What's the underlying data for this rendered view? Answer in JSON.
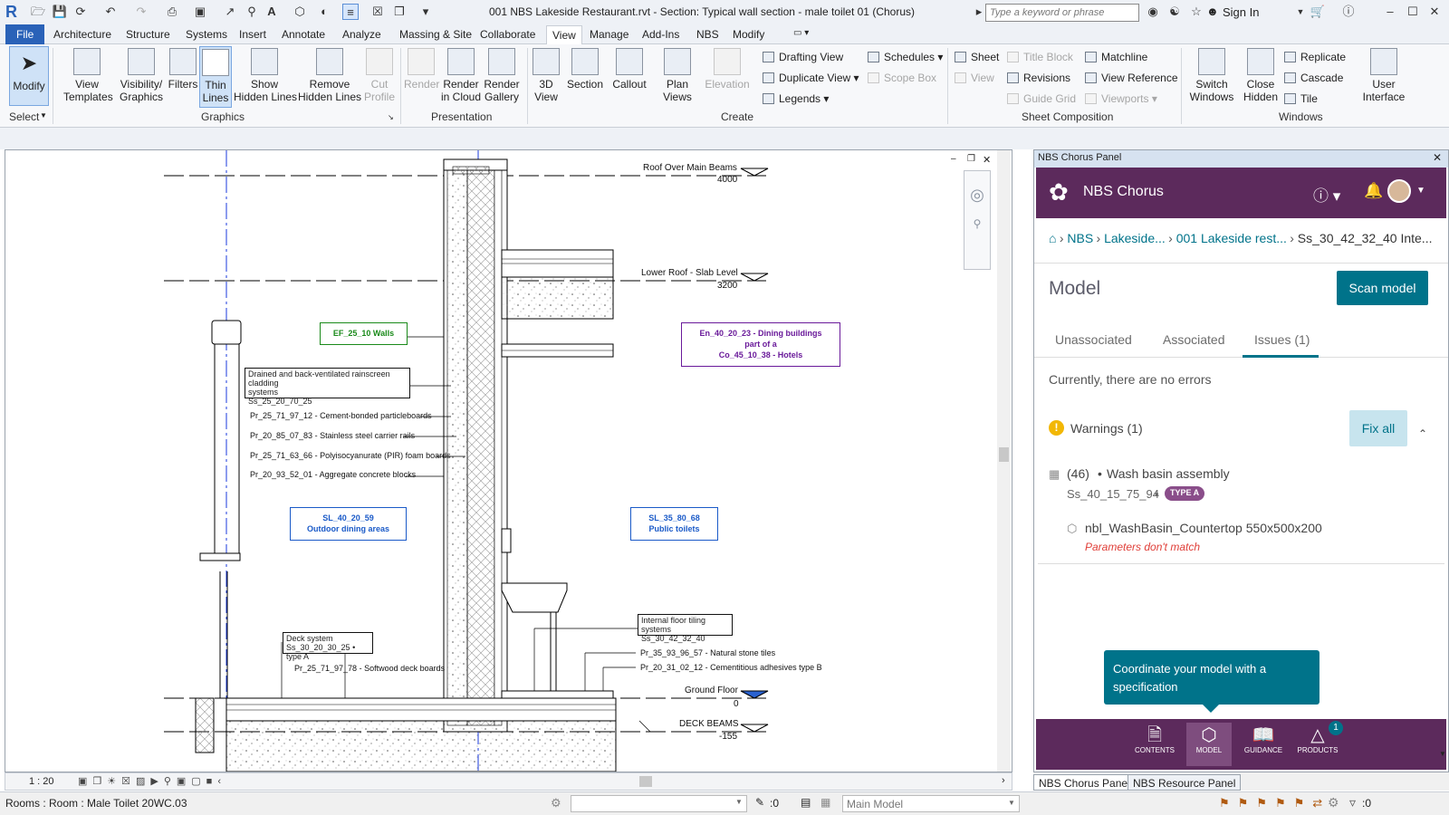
{
  "window": {
    "title": "001 NBS Lakeside Restaurant.rvt - Section: Typical wall section - male toilet 01 (Chorus)",
    "search_placeholder": "Type a keyword or phrase",
    "sign_in": "Sign In"
  },
  "tabs": [
    "File",
    "Architecture",
    "Structure",
    "Systems",
    "Insert",
    "Annotate",
    "Analyze",
    "Massing & Site",
    "Collaborate",
    "View",
    "Manage",
    "Add-Ins",
    "NBS",
    "Modify"
  ],
  "active_tab": "View",
  "ribbon": {
    "modify": "Modify",
    "select": "Select",
    "graphics": {
      "group": "Graphics",
      "view_templates": "View\nTemplates",
      "visibility": "Visibility/\nGraphics",
      "filters": "Filters",
      "thin_lines": "Thin\nLines",
      "show_hidden": "Show\nHidden Lines",
      "remove_hidden": "Remove\nHidden Lines",
      "cut_profile": "Cut\nProfile"
    },
    "presentation": {
      "group": "Presentation",
      "render": "Render",
      "render_cloud": "Render\nin Cloud",
      "render_gallery": "Render\nGallery"
    },
    "create": {
      "group": "Create",
      "view3d": "3D\nView",
      "section": "Section",
      "callout": "Callout",
      "plan_views": "Plan\nViews",
      "elevation": "Elevation",
      "drafting_view": "Drafting View",
      "duplicate_view": "Duplicate View",
      "legends": "Legends",
      "schedules": "Schedules",
      "scope_box": "Scope Box"
    },
    "sheet": {
      "group": "Sheet Composition",
      "sheet": "Sheet",
      "view": "View",
      "title_block": "Title Block",
      "revisions": "Revisions",
      "guide_grid": "Guide Grid",
      "matchline": "Matchline",
      "view_reference": "View Reference",
      "viewports": "Viewports"
    },
    "windows": {
      "group": "Windows",
      "switch_windows": "Switch\nWindows",
      "close_hidden": "Close\nHidden",
      "replicate": "Replicate",
      "cascade": "Cascade",
      "tile": "Tile",
      "user_interface": "User\nInterface"
    }
  },
  "drawing": {
    "level_roof": "Roof Over Main Beams",
    "level_roof_val": "4000",
    "level_lower": "Lower Roof - Slab Level",
    "level_lower_val": "3200",
    "level_ground": "Ground Floor",
    "level_ground_val": "0",
    "level_deck": "DECK BEAMS",
    "level_deck_val": "-155",
    "tag_walls": "EF_25_10 Walls",
    "tag_dining_1": "En_40_20_23 - Dining buildings",
    "tag_dining_2": "part of a",
    "tag_dining_3": "Co_45_10_38 - Hotels",
    "tag_outdoor_1": "SL_40_20_59",
    "tag_outdoor_2": "Outdoor dining areas",
    "tag_toilets_1": "SL_35_80_68",
    "tag_toilets_2": "Public toilets",
    "note_cladding_1": "Drained and back-ventilated rainscreen cladding",
    "note_cladding_2": "systems",
    "note_cladding_3": "Ss_25_20_70_25",
    "note_1": "Pr_25_71_97_12  - Cement-bonded particleboards",
    "note_2": "Pr_20_85_07_83  - Stainless steel carrier rails",
    "note_3": "Pr_25_71_63_66  - Polyisocyanurate (PIR) foam boards",
    "note_4": "Pr_20_93_52_01  - Aggregate concrete blocks",
    "deck_1": "Deck system",
    "deck_2": "Ss_30_20_30_25 • type A",
    "deck_3": "Pr_25_71_97_78  - Softwood deck boards",
    "floor_1": "Internal floor tiling systems",
    "floor_2": "Ss_30_42_32_40",
    "floor_3": "Pr_35_93_96_57  - Natural stone tiles",
    "floor_4": "Pr_20_31_02_12  - Cementitious adhesives type B",
    "scale": "1 : 20"
  },
  "status": {
    "left": "Rooms : Room : Male Toilet 20WC.03",
    "zero1": ":0",
    "model": "Main Model",
    "zero2": ":0"
  },
  "panel": {
    "header": "NBS Chorus Panel",
    "brand": "NBS Chorus",
    "breadcrumb": [
      "NBS",
      "Lakeside...",
      "001 Lakeside rest...",
      "Ss_30_42_32_40 Inte..."
    ],
    "model_title": "Model",
    "scan_button": "Scan model",
    "tabs": [
      "Unassociated",
      "Associated",
      "Issues (1)"
    ],
    "no_errors": "Currently, there are no errors",
    "warnings": "Warnings (1)",
    "fix_all": "Fix all",
    "issue_count": "(46)",
    "issue_name": "Wash basin assembly",
    "issue_code": "Ss_40_15_75_94",
    "issue_badge": "TYPE A",
    "family": "nbl_WashBasin_Countertop 550x500x200",
    "family_error": "Parameters don't match",
    "tooltip": "Coordinate your model with a specification",
    "nav": [
      "CONTENTS",
      "MODEL",
      "GUIDANCE",
      "PRODUCTS"
    ],
    "products_badge": "1",
    "bottom_tabs": [
      "NBS Chorus Panel",
      "NBS Resource Panel"
    ]
  },
  "colors": {
    "file_tab": "#2a62b8",
    "chorus_purple": "#5c2a5c",
    "teal": "#00738a",
    "warning": "#f2b705",
    "error": "#e0403a",
    "tag_green": "#1a8a1a",
    "tag_purple": "#6a1a9a",
    "tag_blue": "#1a5ac8"
  }
}
